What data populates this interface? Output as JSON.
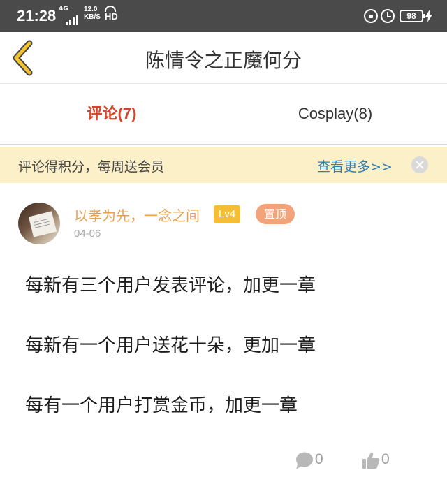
{
  "status_bar": {
    "time": "21:28",
    "network": "4G",
    "speed_value": "12.0",
    "speed_unit": "KB/S",
    "hd": "HD",
    "battery": "98"
  },
  "header": {
    "title": "陈情令之正魔何分",
    "back_icon": "chevron-left-icon",
    "accent_color": "#f2c230"
  },
  "tabs": [
    {
      "label": "评论(7)",
      "active": true
    },
    {
      "label": "Cosplay(8)",
      "active": false
    }
  ],
  "banner": {
    "text": "评论得积分，每周送会员",
    "link": "查看更多>>",
    "close_icon": "close-icon"
  },
  "comment": {
    "username": "以孝为先，一念之间",
    "level": "Lv4",
    "pinned": "置顶",
    "date": "04-06",
    "lines": [
      "每新有三个用户发表评论，加更一章",
      "每新有一个用户送花十朵，更加一章",
      "每有一个用户打赏金币，加更一章"
    ],
    "replies": "0",
    "likes": "0"
  },
  "colors": {
    "active_tab": "#d8452a",
    "username": "#e9a14f",
    "banner_bg": "#fcf0c8",
    "link": "#2f7fb6"
  }
}
